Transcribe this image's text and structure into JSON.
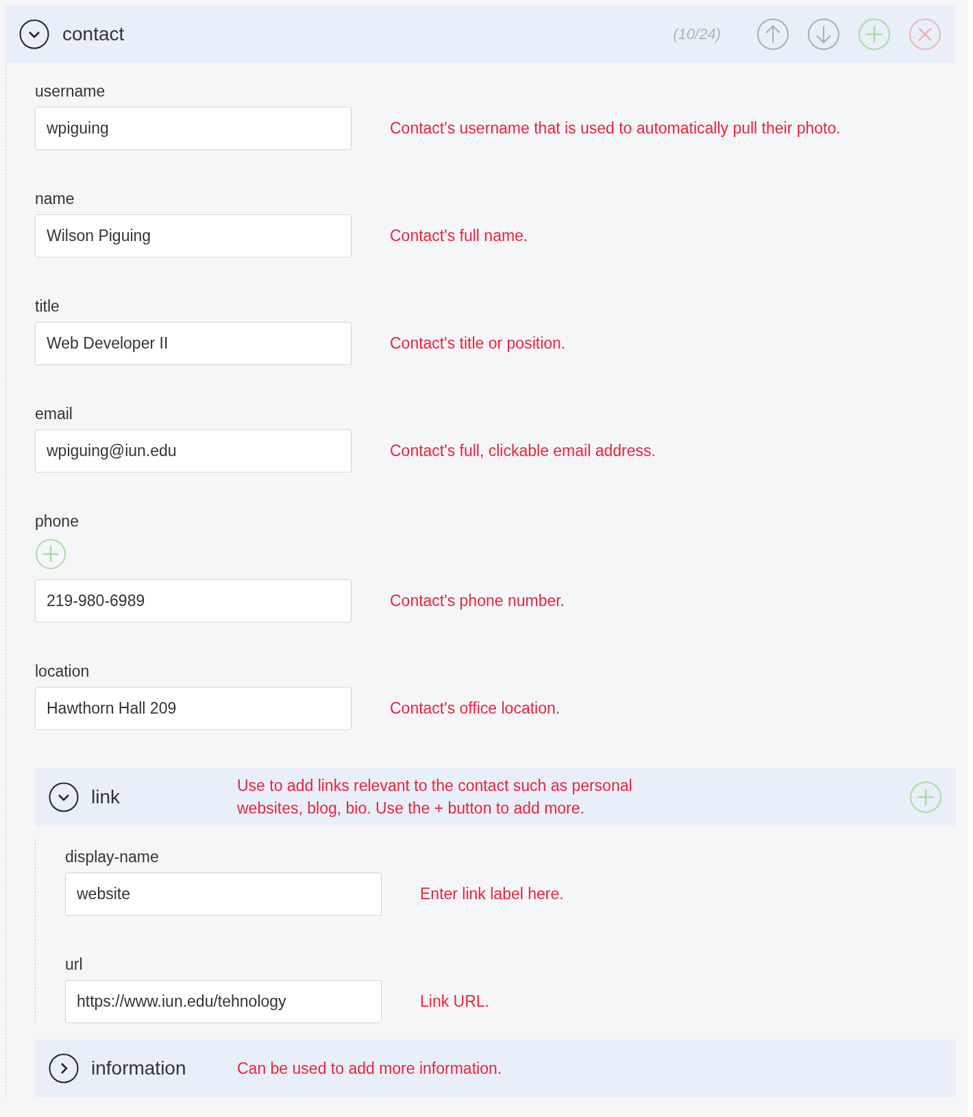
{
  "section": {
    "title": "contact",
    "expanded": true,
    "counter": "(10/24)"
  },
  "fields": [
    {
      "kind": "text",
      "label": "username",
      "value": "wpiguing",
      "note": "Contact's username that is used to automatically pull their photo."
    },
    {
      "kind": "text",
      "label": "name",
      "value": "Wilson Piguing",
      "note": "Contact's full name."
    },
    {
      "kind": "text",
      "label": "title",
      "value": "Web Developer II",
      "note": "Contact's title or position."
    },
    {
      "kind": "text",
      "label": "email",
      "value": "wpiguing@iun.edu",
      "note": "Contact's full, clickable email address."
    },
    {
      "kind": "repeatable",
      "label": "phone",
      "value": "219-980-6989",
      "note": "Contact's phone number."
    },
    {
      "kind": "text",
      "label": "location",
      "value": "Hawthorn Hall 209",
      "note": "Contact's office location."
    }
  ],
  "subsections": [
    {
      "title": "link",
      "expanded": true,
      "note": "Use to add links relevant to the contact such as personal websites, blog, bio. Use the + button to add more.",
      "fields": [
        {
          "label": "display-name",
          "value": "website",
          "note": "Enter link label here."
        },
        {
          "label": "url",
          "value": "https://www.iun.edu/tehnology",
          "note": "Link URL."
        }
      ]
    },
    {
      "title": "information",
      "expanded": false,
      "note": "Can be used to add more information."
    }
  ]
}
